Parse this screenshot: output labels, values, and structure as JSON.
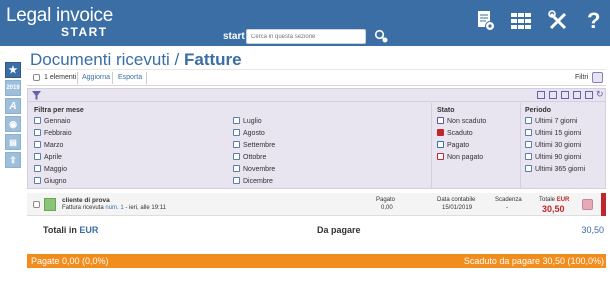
{
  "header": {
    "logo_main": "Legal invoice",
    "logo_sub": "START",
    "start_label": "start",
    "search_placeholder": "Cerca in questa sezione"
  },
  "sidebar": {
    "year": "2019"
  },
  "page": {
    "title_prefix": "Documenti ricevuti / ",
    "title_main": "Fatture"
  },
  "toolbar": {
    "count_label": "1 elementi",
    "update_label": "Aggiorna",
    "export_label": "Esporta",
    "filters_label": "Filtri"
  },
  "filters": {
    "month_header": "Filtra per mese",
    "months_col1": [
      "Gennaio",
      "Febbraio",
      "Marzo",
      "Aprile",
      "Maggio",
      "Giugno"
    ],
    "months_col2": [
      "Luglio",
      "Agosto",
      "Settembre",
      "Ottobre",
      "Novembre",
      "Dicembre"
    ],
    "state_header": "Stato",
    "states": [
      "Non scaduto",
      "Scaduto",
      "Pagato",
      "Non pagato"
    ],
    "period_header": "Periodo",
    "periods": [
      "Ultimi 7 giorni",
      "Ultimi 15 giorni",
      "Ultimi 30 giorni",
      "Ultimi 90 giorni",
      "Ultimi 365 giorni"
    ]
  },
  "document": {
    "client": "cliente di prova",
    "received_label": "Fattura ricevuta",
    "number_label": "num. 1",
    "date_info": "- ieri, alle 19:11",
    "paid_label": "Pagato",
    "paid_value": "0,00",
    "accounting_date_label": "Data contabile",
    "accounting_date": "15/01/2019",
    "due_label": "Scadenza",
    "due_value": "-",
    "total_label": "Totale",
    "total_currency": "EUR",
    "total_value": "30,50"
  },
  "totals": {
    "label": "Totali in",
    "currency": "EUR",
    "to_pay_label": "Da pagare",
    "to_pay_value": "30,50"
  },
  "footer": {
    "paid": "Pagate 0,00 (0,0%)",
    "overdue": "Scaduto da pagare 30,50 (100,0%)"
  },
  "colors": {
    "brand": "#3a6ea5",
    "filter_bg": "#e8e4f0",
    "overdue_bar": "#f28c1c",
    "total_red": "#c0262c"
  }
}
